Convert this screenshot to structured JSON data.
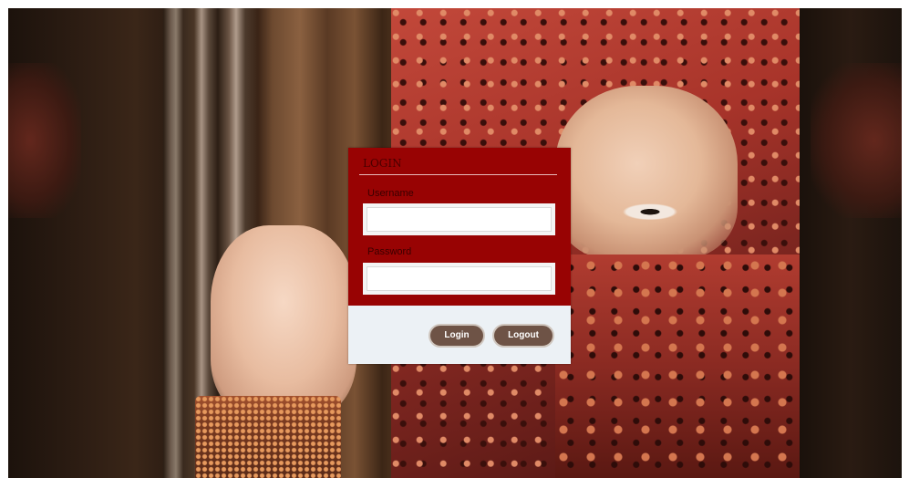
{
  "login": {
    "title": "LOGIN",
    "username_label": "Username",
    "username_value": "",
    "password_label": "Password",
    "password_value": "",
    "login_button": "Login",
    "logout_button": "Logout"
  },
  "colors": {
    "panel_red": "#980303",
    "panel_footer": "#ecf1f5",
    "button_brown": "#6e5346"
  }
}
